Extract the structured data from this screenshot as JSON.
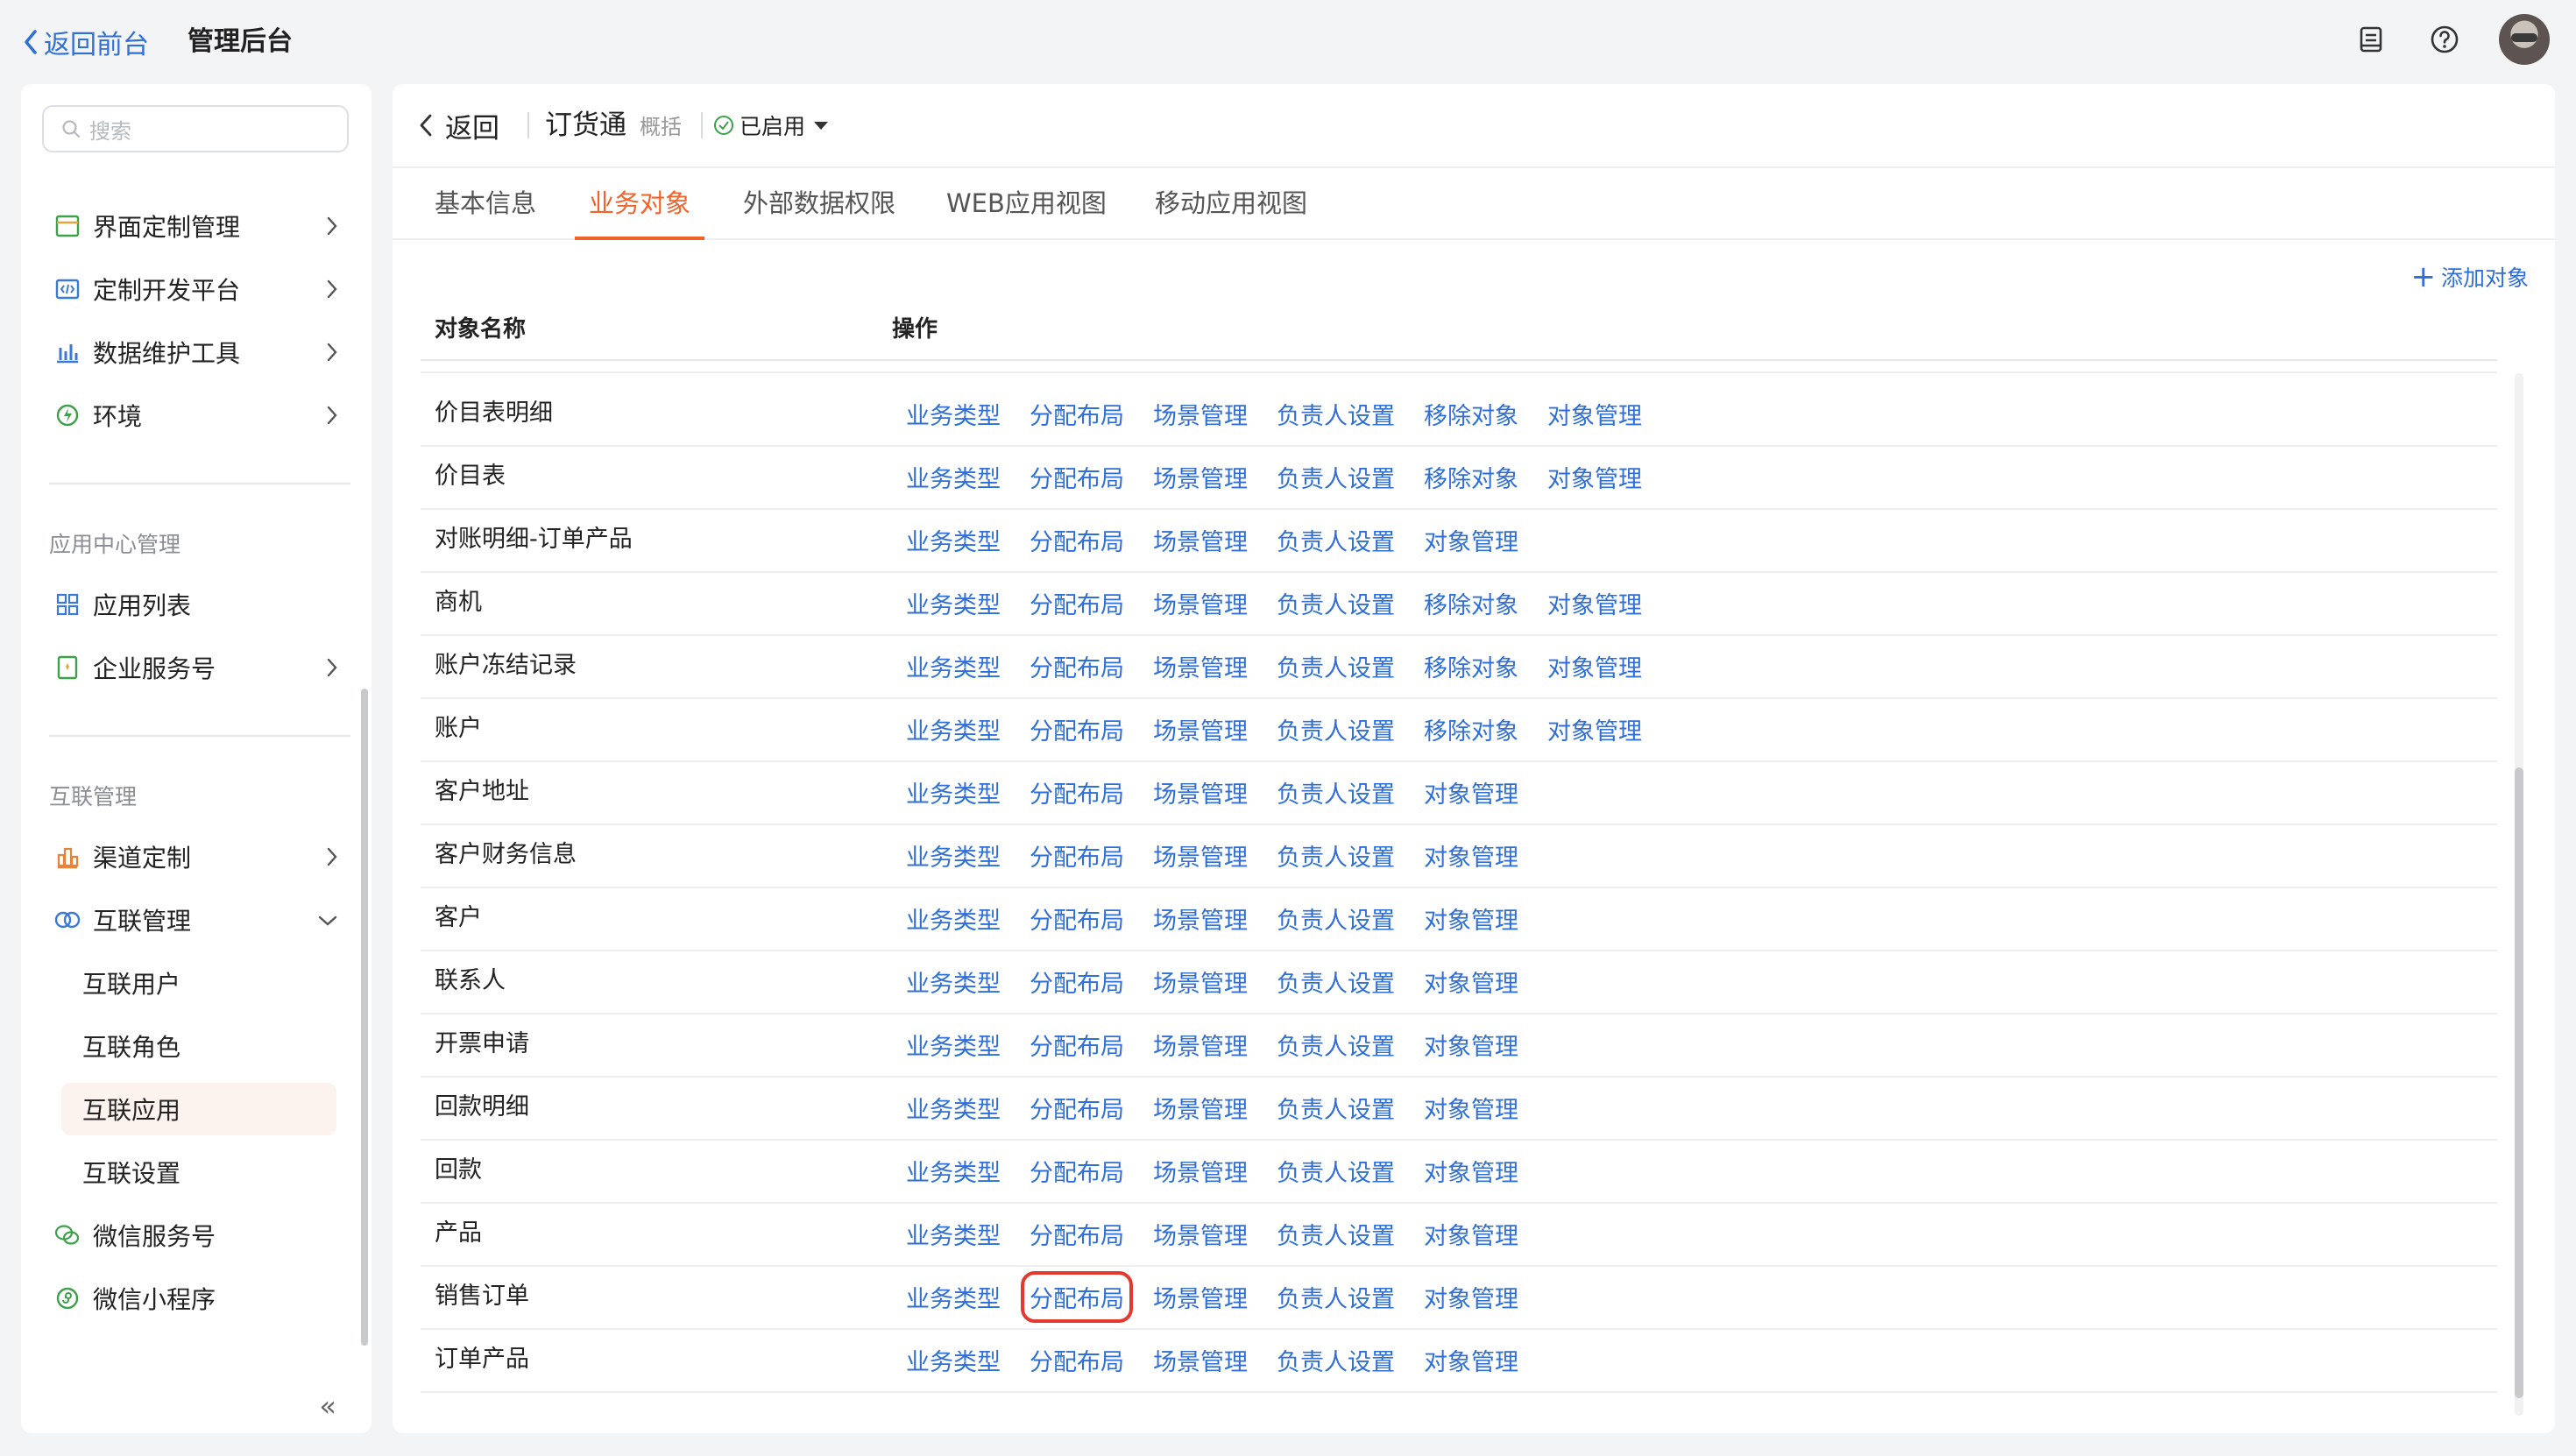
{
  "topbar": {
    "back_label": "返回前台",
    "title": "管理后台",
    "icons": [
      "clipboard-icon",
      "help-icon",
      "user-avatar"
    ]
  },
  "sidebar": {
    "search_placeholder": "搜索",
    "items": [
      {
        "label": "界面定制管理",
        "icon": "layout-icon"
      },
      {
        "label": "定制开发平台",
        "icon": "code-icon"
      },
      {
        "label": "数据维护工具",
        "icon": "bar-chart-icon"
      },
      {
        "label": "环境",
        "icon": "environment-icon"
      }
    ],
    "group_app": "应用中心管理",
    "app_items": [
      {
        "label": "应用列表",
        "icon": "grid-icon"
      },
      {
        "label": "企业服务号",
        "icon": "service-icon"
      }
    ],
    "group_interconnect": "互联管理",
    "interconnect_items": [
      {
        "label": "渠道定制",
        "icon": "channel-icon"
      },
      {
        "label": "互联管理",
        "icon": "link-icon"
      }
    ],
    "sub_items": [
      "互联用户",
      "互联角色",
      "互联应用",
      "互联设置"
    ],
    "active_sub": "互联应用",
    "bottom_items": [
      {
        "label": "微信服务号",
        "icon": "wechat-icon"
      },
      {
        "label": "微信小程序",
        "icon": "miniprogram-icon"
      }
    ],
    "collapse_label": "«"
  },
  "header": {
    "back_label": "返回",
    "app_name": "订货通",
    "summary": "概括",
    "status": "已启用"
  },
  "tabs": [
    "基本信息",
    "业务对象",
    "外部数据权限",
    "WEB应用视图",
    "移动应用视图"
  ],
  "active_tab": "业务对象",
  "add_object_label": "添加对象",
  "table": {
    "col_name": "对象名称",
    "col_ops": "操作",
    "rows": [
      {
        "name": "价目表明细",
        "ops": [
          "业务类型",
          "分配布局",
          "场景管理",
          "负责人设置",
          "移除对象",
          "对象管理"
        ]
      },
      {
        "name": "价目表",
        "ops": [
          "业务类型",
          "分配布局",
          "场景管理",
          "负责人设置",
          "移除对象",
          "对象管理"
        ]
      },
      {
        "name": "对账明细-订单产品",
        "ops": [
          "业务类型",
          "分配布局",
          "场景管理",
          "负责人设置",
          "对象管理"
        ]
      },
      {
        "name": "商机",
        "ops": [
          "业务类型",
          "分配布局",
          "场景管理",
          "负责人设置",
          "移除对象",
          "对象管理"
        ]
      },
      {
        "name": "账户冻结记录",
        "ops": [
          "业务类型",
          "分配布局",
          "场景管理",
          "负责人设置",
          "移除对象",
          "对象管理"
        ]
      },
      {
        "name": "账户",
        "ops": [
          "业务类型",
          "分配布局",
          "场景管理",
          "负责人设置",
          "移除对象",
          "对象管理"
        ]
      },
      {
        "name": "客户地址",
        "ops": [
          "业务类型",
          "分配布局",
          "场景管理",
          "负责人设置",
          "对象管理"
        ]
      },
      {
        "name": "客户财务信息",
        "ops": [
          "业务类型",
          "分配布局",
          "场景管理",
          "负责人设置",
          "对象管理"
        ]
      },
      {
        "name": "客户",
        "ops": [
          "业务类型",
          "分配布局",
          "场景管理",
          "负责人设置",
          "对象管理"
        ]
      },
      {
        "name": "联系人",
        "ops": [
          "业务类型",
          "分配布局",
          "场景管理",
          "负责人设置",
          "对象管理"
        ]
      },
      {
        "name": "开票申请",
        "ops": [
          "业务类型",
          "分配布局",
          "场景管理",
          "负责人设置",
          "对象管理"
        ]
      },
      {
        "name": "回款明细",
        "ops": [
          "业务类型",
          "分配布局",
          "场景管理",
          "负责人设置",
          "对象管理"
        ]
      },
      {
        "name": "回款",
        "ops": [
          "业务类型",
          "分配布局",
          "场景管理",
          "负责人设置",
          "对象管理"
        ]
      },
      {
        "name": "产品",
        "ops": [
          "业务类型",
          "分配布局",
          "场景管理",
          "负责人设置",
          "对象管理"
        ]
      },
      {
        "name": "销售订单",
        "ops": [
          "业务类型",
          "分配布局",
          "场景管理",
          "负责人设置",
          "对象管理"
        ],
        "highlight_op": "分配布局"
      },
      {
        "name": "订单产品",
        "ops": [
          "业务类型",
          "分配布局",
          "场景管理",
          "负责人设置",
          "对象管理"
        ]
      }
    ]
  },
  "colors": {
    "link": "#2f6fd6",
    "accent": "#f0632a",
    "highlight_box": "#e23a2e"
  }
}
